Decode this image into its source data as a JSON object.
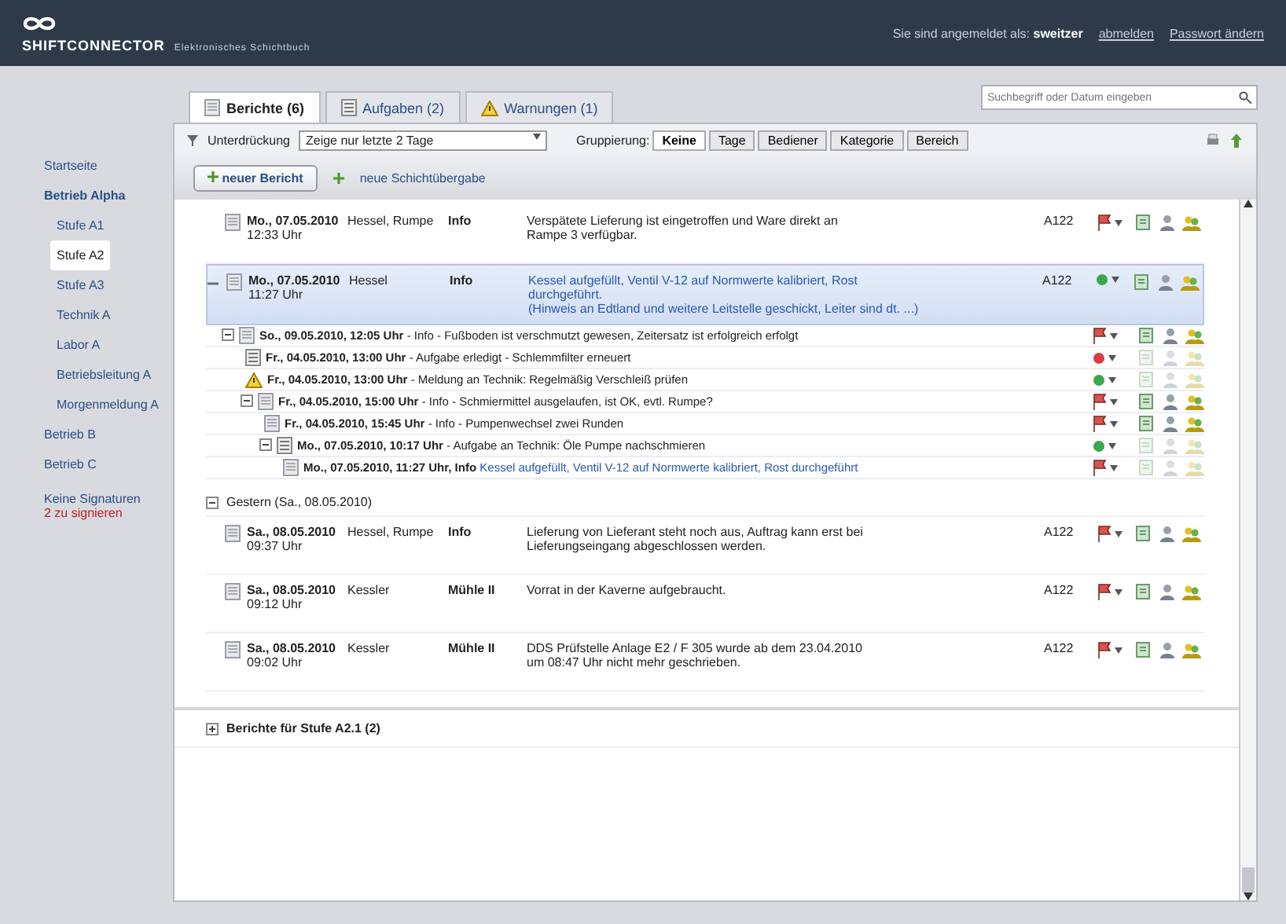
{
  "header": {
    "product": "SHIFTCONNECTOR",
    "subtitle": "Elektronisches Schichtbuch",
    "login_text": "Sie sind angemeldet als:",
    "user": "sweitzer",
    "links": [
      "abmelden",
      "Passwort ändern"
    ]
  },
  "sidebar": {
    "items": [
      {
        "label": "Startseite",
        "selected": false
      },
      {
        "label": "Betrieb Alpha",
        "selected": false,
        "children": [
          {
            "label": "Stufe A1",
            "selected": false
          },
          {
            "label": "Stufe A2",
            "selected": true
          },
          {
            "label": "Stufe A3",
            "selected": false
          },
          {
            "label": "Technik A",
            "selected": false
          },
          {
            "label": "Labor A",
            "selected": false
          },
          {
            "label": "Betriebsleitung A",
            "selected": false
          },
          {
            "label": "Morgenmeldung A",
            "selected": false
          }
        ]
      },
      {
        "label": "Betrieb B",
        "selected": false
      },
      {
        "label": "Betrieb C",
        "selected": false
      }
    ],
    "signature": {
      "title": "Keine Signaturen",
      "alert": "2 zu signieren"
    }
  },
  "tabs": [
    {
      "label": "Berichte (6)",
      "kind": "report",
      "selected": true
    },
    {
      "label": "Aufgaben (2)",
      "kind": "task",
      "selected": false
    },
    {
      "label": "Warnungen (1)",
      "kind": "warning",
      "selected": false
    }
  ],
  "search": {
    "placeholder": "Suchbegriff oder Datum eingeben"
  },
  "filter": {
    "label": "Unterdrückung",
    "value": "Zeige nur letzte 2 Tage"
  },
  "grouping": {
    "label": "Gruppierung:",
    "options": [
      {
        "label": "Keine",
        "selected": true
      },
      {
        "label": "Tage",
        "selected": false
      },
      {
        "label": "Bediener",
        "selected": false
      },
      {
        "label": "Kategorie",
        "selected": false
      },
      {
        "label": "Bereich",
        "selected": false
      }
    ]
  },
  "actions": {
    "new_report": "neuer Bericht",
    "new_handover": "neue Schichtübergabe"
  },
  "reports": [
    {
      "date": "Mo., 07.05.2010",
      "time": "12:33 Uhr",
      "author": "Hessel, Rumpe",
      "category": "Info",
      "text": [
        "Verspätete Lieferung ist eingetroffen und Ware direkt an",
        "Rampe 3 verfügbar."
      ],
      "area": "A122",
      "status": {
        "kind": "flag"
      },
      "expanded": false,
      "selected": false
    },
    {
      "date": "Mo., 07.05.2010",
      "time": "11:27 Uhr",
      "author": "Hessel",
      "category": "Info",
      "text": [
        "Kessel aufgefüllt, Ventil V-12 auf Normwerte kalibriert, Rost",
        "durchgeführt.",
        "(Hinweis an Edtland und weitere Leitstelle geschickt, Leiter sind dt. ...)"
      ],
      "area": "A122",
      "status": {
        "kind": "green"
      },
      "expanded": true,
      "selected": true,
      "children": [
        {
          "text": "**So., 09.05.2010, 12:05 Uhr** - Info - Fußboden ist verschmutzt gewesen, Zeitersatz ist erfolgreich erfolgt",
          "kind": "report",
          "status": {
            "kind": "flag"
          },
          "dimmed": false,
          "children": [
            {
              "text": "**Fr., 04.05.2010, 13:00 Uhr** - Aufgabe erledigt - Schlemmfilter erneuert",
              "kind": "task",
              "status": {
                "kind": "red"
              },
              "dimmed": true
            },
            {
              "text": "**Fr., 04.05.2010, 13:00 Uhr** - Meldung an Technik: Regelmäßig Verschleiß prüfen",
              "kind": "warning",
              "status": {
                "kind": "green"
              },
              "dimmed": true
            },
            {
              "text": "**Fr., 04.05.2010, 15:00 Uhr** - Info - Schmiermittel ausgelaufen, ist OK, evtl. Rumpe?",
              "kind": "report",
              "status": {
                "kind": "flag"
              },
              "dimmed": false,
              "children": [
                {
                  "text": "**Fr., 04.05.2010, 15:45 Uhr** - Info - Pumpenwechsel zwei Runden",
                  "kind": "report",
                  "status": {
                    "kind": "flag"
                  },
                  "dimmed": false
                },
                {
                  "text": "**Mo., 07.05.2010, 10:17 Uhr** - Aufgabe an Technik: Öle Pumpe nachschmieren",
                  "kind": "task",
                  "status": {
                    "kind": "green"
                  },
                  "dimmed": true,
                  "children": [
                    {
                      "text": "**Mo., 07.05.2010, 11:27 Uhr, Info**",
                      "detail": "Kessel aufgefüllt, Ventil V-12 auf Normwerte kalibriert, Rost durchgeführt",
                      "kind": "report",
                      "status": {
                        "kind": "flag"
                      },
                      "dimmed": true
                    }
                  ]
                }
              ]
            }
          ]
        }
      ]
    }
  ],
  "groups": [
    {
      "title": "Gestern (Sa., 08.05.2010)",
      "kind": "day",
      "expanded": true,
      "reports": [
        {
          "date": "Sa., 08.05.2010",
          "time": "09:37 Uhr",
          "author": "Hessel, Rumpe",
          "category": "Info",
          "text": [
            "Lieferung von Lieferant steht noch aus, Auftrag kann erst bei",
            "Lieferungseingang abgeschlossen werden."
          ],
          "area": "A122",
          "status": {
            "kind": "flag"
          },
          "expanded": false,
          "selected": false
        },
        {
          "date": "Sa., 08.05.2010",
          "time": "09:12 Uhr",
          "author": "Kessler",
          "category": "Mühle II",
          "text": [
            "Vorrat in der Kaverne aufgebraucht."
          ],
          "area": "A122",
          "status": {
            "kind": "flag"
          },
          "expanded": false,
          "selected": false
        },
        {
          "date": "Sa., 08.05.2010",
          "time": "09:02 Uhr",
          "author": "Kessler",
          "category": "Mühle II",
          "text": [
            "DDS Prüfstelle Anlage E2 / F 305 wurde ab dem 23.04.2010",
            "um 08:47 Uhr nicht mehr geschrieben."
          ],
          "area": "A122",
          "status": {
            "kind": "flag"
          },
          "expanded": false,
          "selected": false
        }
      ]
    },
    {
      "title": "Berichte für Stufe A2.1 (2)",
      "kind": "section",
      "expanded": false
    }
  ]
}
